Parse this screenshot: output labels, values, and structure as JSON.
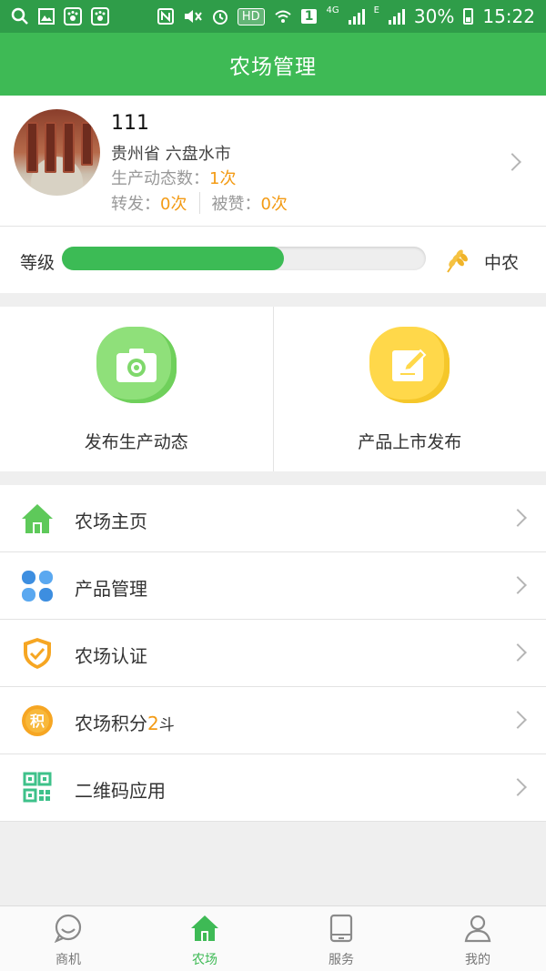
{
  "status_bar": {
    "hd": "HD",
    "net": "4G",
    "edge": "E",
    "sim": "1",
    "battery": "30%",
    "time": "15:22"
  },
  "header": {
    "title": "农场管理"
  },
  "profile": {
    "name": "111",
    "location": "贵州省 六盘水市",
    "dynamics_label": "生产动态数：",
    "dynamics_value": "1次",
    "forward_label": "转发：",
    "forward_value": "0次",
    "likes_label": "被赞：",
    "likes_value": "0次"
  },
  "level": {
    "label": "等级",
    "rank": "中农",
    "progress_percent": 61,
    "fill_color": "#3cbb55"
  },
  "actions": [
    {
      "label": "发布生产动态",
      "icon": "camera-icon",
      "color": "#8fe07a"
    },
    {
      "label": "产品上市发布",
      "icon": "edit-icon",
      "color": "#ffd84a"
    }
  ],
  "menu": {
    "items": [
      {
        "label": "农场主页",
        "icon": "home-icon"
      },
      {
        "label": "产品管理",
        "icon": "grid-icon"
      },
      {
        "label": "农场认证",
        "icon": "shield-check-icon"
      },
      {
        "label": "农场积分",
        "value": "2",
        "unit": "斗",
        "icon": "points-icon",
        "icon_text": "积"
      },
      {
        "label": "二维码应用",
        "icon": "qrcode-icon"
      }
    ]
  },
  "bottom_nav": [
    {
      "label": "商机",
      "icon": "chat-icon"
    },
    {
      "label": "农场",
      "icon": "home-icon",
      "active": true
    },
    {
      "label": "服务",
      "icon": "tablet-icon"
    },
    {
      "label": "我的",
      "icon": "user-icon"
    }
  ],
  "colors": {
    "primary": "#3eba55",
    "status_bar": "#2f9d49",
    "accent": "#f39b15"
  }
}
